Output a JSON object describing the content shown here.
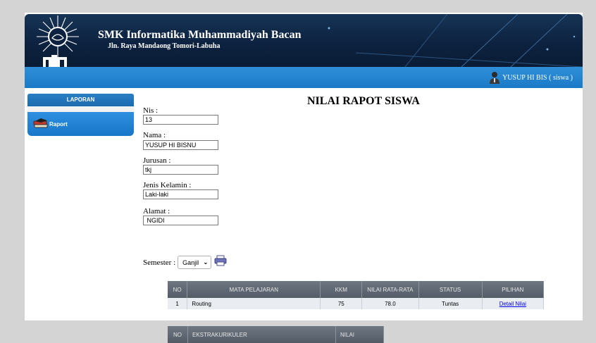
{
  "header": {
    "school_name": "SMK Informatika Muhammadiyah Bacan",
    "address": "Jln. Raya Mandaong Tomori-Labuha",
    "user_label": "YUSUP HI BIS ( siswa )"
  },
  "sidebar": {
    "section_title": "LAPORAN",
    "items": [
      {
        "label": "Raport",
        "icon": "book-stack-icon"
      }
    ]
  },
  "form": {
    "title": "NILAI RAPOT SISWA",
    "fields": [
      {
        "label": "Nis :",
        "value": "13"
      },
      {
        "label": "Nama :",
        "value": "YUSUP HI BISNU"
      },
      {
        "label": "Jurusan :",
        "value": "tkj"
      },
      {
        "label": "Jenis Kelamin :",
        "value": "Laki-laki"
      },
      {
        "label": "Alamat :",
        "value": " NGIDI"
      }
    ],
    "semester": {
      "label": "Semester :",
      "selected": "Ganjil"
    }
  },
  "grades_table": {
    "columns": [
      "NO",
      "MATA PELAJARAN",
      "KKM",
      "NILAI RATA-RATA",
      "STATUS",
      "PILIHAN"
    ],
    "rows": [
      {
        "no": "1",
        "subject": "Routing",
        "kkm": "75",
        "avg": "78.0",
        "status": "Tuntas",
        "action": "Detail Nilai"
      }
    ]
  },
  "extracurricular_table": {
    "columns": [
      "NO",
      "EKSTRAKURIKULER",
      "NILAI"
    ]
  },
  "colors": {
    "banner": "#0d2240",
    "bar_blue": "#1b7ac7",
    "table_header": "#5f6872",
    "table_row": "#e9edf2",
    "link": "#0000ee"
  }
}
